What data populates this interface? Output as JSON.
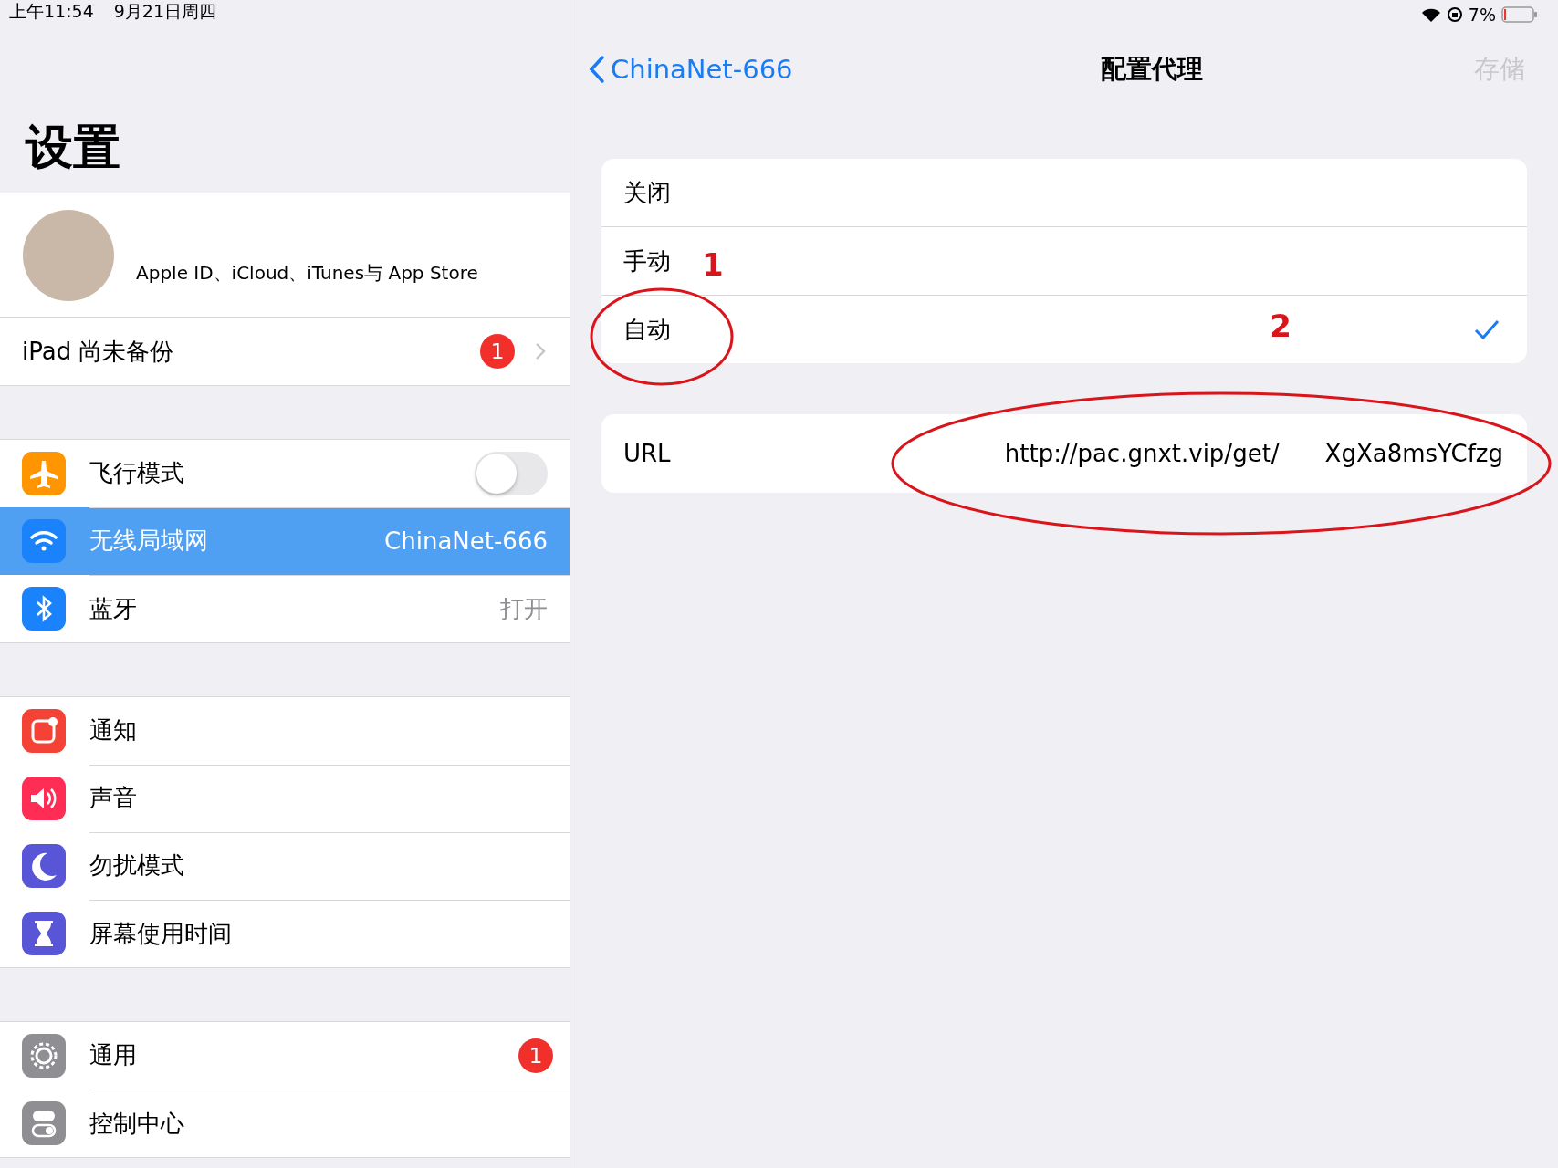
{
  "status_bar": {
    "time": "上午11:54",
    "date": "9月21日周四",
    "battery": "7%",
    "battery_meter": {
      "level": 0.07
    }
  },
  "sidebar": {
    "title": "设置",
    "profile": {
      "subtitle": "Apple ID、iCloud、iTunes与 App Store"
    },
    "backup": {
      "label": "iPad 尚未备份",
      "badge": "1"
    },
    "groups": [
      [
        {
          "kind": "toggle",
          "label": "飞行模式",
          "on": false,
          "selected": false,
          "color": "#ff9500"
        },
        {
          "kind": "value",
          "label": "无线局域网",
          "value": "ChinaNet-666",
          "selected": true,
          "color": "#1a82fb"
        },
        {
          "kind": "value",
          "label": "蓝牙",
          "value": "打开",
          "selected": false,
          "color": "#1a82fb"
        }
      ],
      [
        {
          "kind": "plain",
          "label": "通知",
          "selected": false,
          "color": "#f44336"
        },
        {
          "kind": "plain",
          "label": "声音",
          "selected": false,
          "color": "#ff2d55"
        },
        {
          "kind": "plain",
          "label": "勿扰模式",
          "selected": false,
          "color": "#5856d6"
        },
        {
          "kind": "plain",
          "label": "屏幕使用时间",
          "selected": false,
          "color": "#5856d6"
        }
      ],
      [
        {
          "kind": "badge",
          "label": "通用",
          "badge": "1",
          "selected": false,
          "color": "#8e8e93"
        },
        {
          "kind": "plain",
          "label": "控制中心",
          "selected": false,
          "color": "#8e8e93"
        }
      ]
    ]
  },
  "detail": {
    "nav": {
      "back": "ChinaNet-666",
      "title": "配置代理",
      "action": "存储",
      "action_disabled": true
    },
    "options": [
      {
        "label": "关闭",
        "selected": false
      },
      {
        "label": "手动",
        "selected": false,
        "mark": "1"
      },
      {
        "label": "自动",
        "selected": true,
        "mark": "2"
      }
    ],
    "url": {
      "label": "URL",
      "value_start": "http://pac.gnxt.vip/get/",
      "value_end": "XgXa8msYCfzg"
    }
  }
}
